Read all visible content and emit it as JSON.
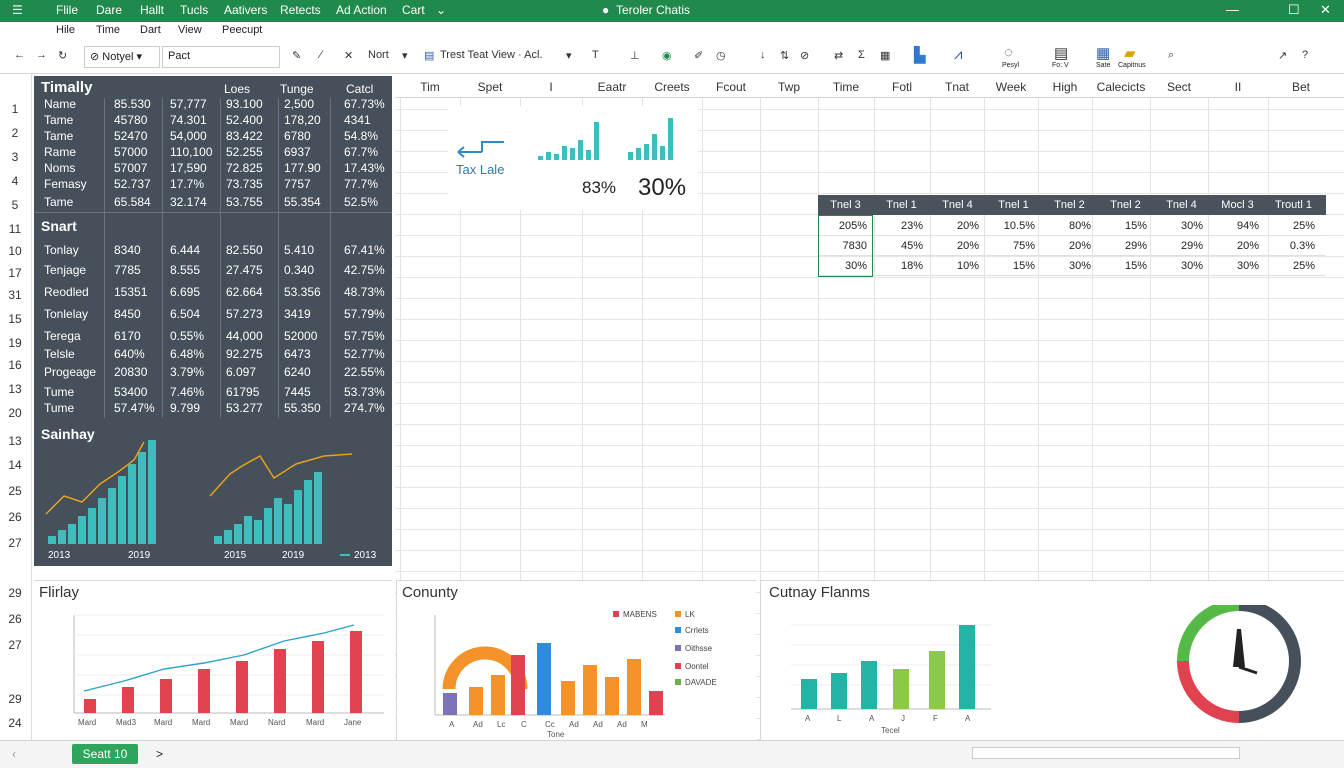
{
  "titlebar": {
    "menu_items": [
      "Flile",
      "Dare",
      "Hallt",
      "Tucls",
      "Aativers",
      "Retects",
      "Ad Action",
      "Cart"
    ],
    "title": "Teroler Chatis",
    "accent": "#1f8a4c"
  },
  "menubar": {
    "items": [
      "Hile",
      "Time",
      "Dart",
      "View",
      "Peecupt"
    ]
  },
  "toolbar": {
    "font_box": "Notyel",
    "size_box": "Pact",
    "nort_label": "Nort",
    "view_label": "Trest Teat View · Acl.",
    "icons_right": [
      "Pesyl",
      "Fo: V",
      "Sate",
      "Capitnus"
    ]
  },
  "row_numbers": [
    "1",
    "2",
    "3",
    "4",
    "5",
    "11",
    "10",
    "17",
    "31",
    "15",
    "19",
    "16",
    "13",
    "20",
    "13",
    "14",
    "25",
    "26",
    "27",
    "29",
    "26",
    "27",
    "29",
    "24"
  ],
  "col_headers": [
    "Tim",
    "Spet",
    "I",
    "Eaatr",
    "Creets",
    "Fcout",
    "Twp",
    "Time",
    "Fotl",
    "Tnat",
    "Week",
    "High",
    "Calecicts",
    "Sect",
    "II",
    "Bet"
  ],
  "dark_panel": {
    "section1_title": "Timally",
    "section1_headers": [
      "Loes",
      "Tunge",
      "Catcl"
    ],
    "section1_rows": [
      {
        "label": "Name",
        "v": [
          "85.530",
          "57,777",
          "93.100",
          "2,500",
          "67.73%"
        ]
      },
      {
        "label": "Tame",
        "v": [
          "45780",
          "74.301",
          "52.400",
          "178,20",
          "4341"
        ]
      },
      {
        "label": "Tame",
        "v": [
          "52470",
          "54,000",
          "83.422",
          "6780",
          "54.8%"
        ]
      },
      {
        "label": "Rame",
        "v": [
          "57000",
          "110,100",
          "52.255",
          "6937",
          "67.7%"
        ]
      },
      {
        "label": "Noms",
        "v": [
          "57007",
          "17,590",
          "72.825",
          "177.90",
          "17.43%"
        ]
      },
      {
        "label": "Femasy",
        "v": [
          "52.737",
          "17.7%",
          "73.735",
          "7757",
          "77.7%"
        ]
      }
    ],
    "total_row": {
      "label": "Tame",
      "v": [
        "65.584",
        "32.174",
        "53.755",
        "55.354",
        "52.5%"
      ]
    },
    "section2_title": "Snart",
    "section2_rows": [
      {
        "label": "Tonlay",
        "v": [
          "8340",
          "6.444",
          "82.550",
          "5.410",
          "67.41%"
        ]
      },
      {
        "label": "Tenjage",
        "v": [
          "7785",
          "8.555",
          "27.475",
          "0.340",
          "42.75%"
        ]
      },
      {
        "label": "Reodled",
        "v": [
          "15351",
          "6.695",
          "62.664",
          "53.356",
          "48.73%"
        ]
      },
      {
        "label": "Tonlelay",
        "v": [
          "8450",
          "6.504",
          "57.273",
          "3419",
          "57.79%"
        ]
      },
      {
        "label": "Terega",
        "v": [
          "6170",
          "0.55%",
          "44,000",
          "52000",
          "57.75%"
        ]
      },
      {
        "label": "Telsle",
        "v": [
          "640%",
          "6.48%",
          "92.275",
          "6473",
          "52.77%"
        ]
      },
      {
        "label": "Progeage",
        "v": [
          "20830",
          "3.79%",
          "6.097",
          "6240",
          "22.55%"
        ]
      },
      {
        "label": "Tume",
        "v": [
          "53400",
          "7.46%",
          "61795",
          "7445",
          "53.73%"
        ]
      },
      {
        "label": "Tume",
        "v": [
          "57.47%",
          "9.799",
          "53.277",
          "55.350",
          "274.7%"
        ]
      }
    ],
    "section3_title": "Sainhay",
    "section3_labels": [
      "2013",
      "2019",
      "2015",
      "2019",
      "2013"
    ]
  },
  "kpi": {
    "caption": "Tax Lale",
    "pct1": "83%",
    "pct2": "30%"
  },
  "mini_table": {
    "headers": [
      "Tnel 3",
      "Tnel 1",
      "Tnel 4",
      "Tnel 1",
      "Tnel 2",
      "Tnel 2",
      "Tnel 4",
      "Mocl 3",
      "Troutl 1"
    ],
    "rows": [
      [
        "205%",
        "23%",
        "20%",
        "10.5%",
        "80%",
        "15%",
        "30%",
        "94%",
        "25%"
      ],
      [
        "7830",
        "45%",
        "20%",
        "75%",
        "20%",
        "29%",
        "29%",
        "20%",
        "0.3%"
      ],
      [
        "30%",
        "18%",
        "10%",
        "15%",
        "30%",
        "15%",
        "30%",
        "30%",
        "25%"
      ]
    ]
  },
  "bottom_panels": [
    {
      "title": "Flirlay",
      "x_labels": [
        "Mard",
        "Mad3",
        "Mard",
        "Mard",
        "Mard",
        "Nard",
        "Mard",
        "Jane"
      ],
      "bar_color": "#e0434f",
      "line_color": "#2aa3c8"
    },
    {
      "title": "Conunty",
      "x_labels": [
        "A",
        "Ad",
        "Lc",
        "C",
        "Cc",
        "Ad",
        "Ad",
        "Ad",
        "M"
      ],
      "legend": [
        "MABENS",
        "LK",
        "Crrlets",
        "Oithsse",
        "Oontel",
        "DAVADE"
      ],
      "x_title": "Tone"
    },
    {
      "title": "Cutnay Flanms",
      "x_labels": [
        "A",
        "L",
        "A",
        "J",
        "F",
        "A"
      ],
      "x_title": "Tecel"
    }
  ],
  "statusbar": {
    "sheet_tab": "Seatt 10",
    "nav": ">"
  }
}
